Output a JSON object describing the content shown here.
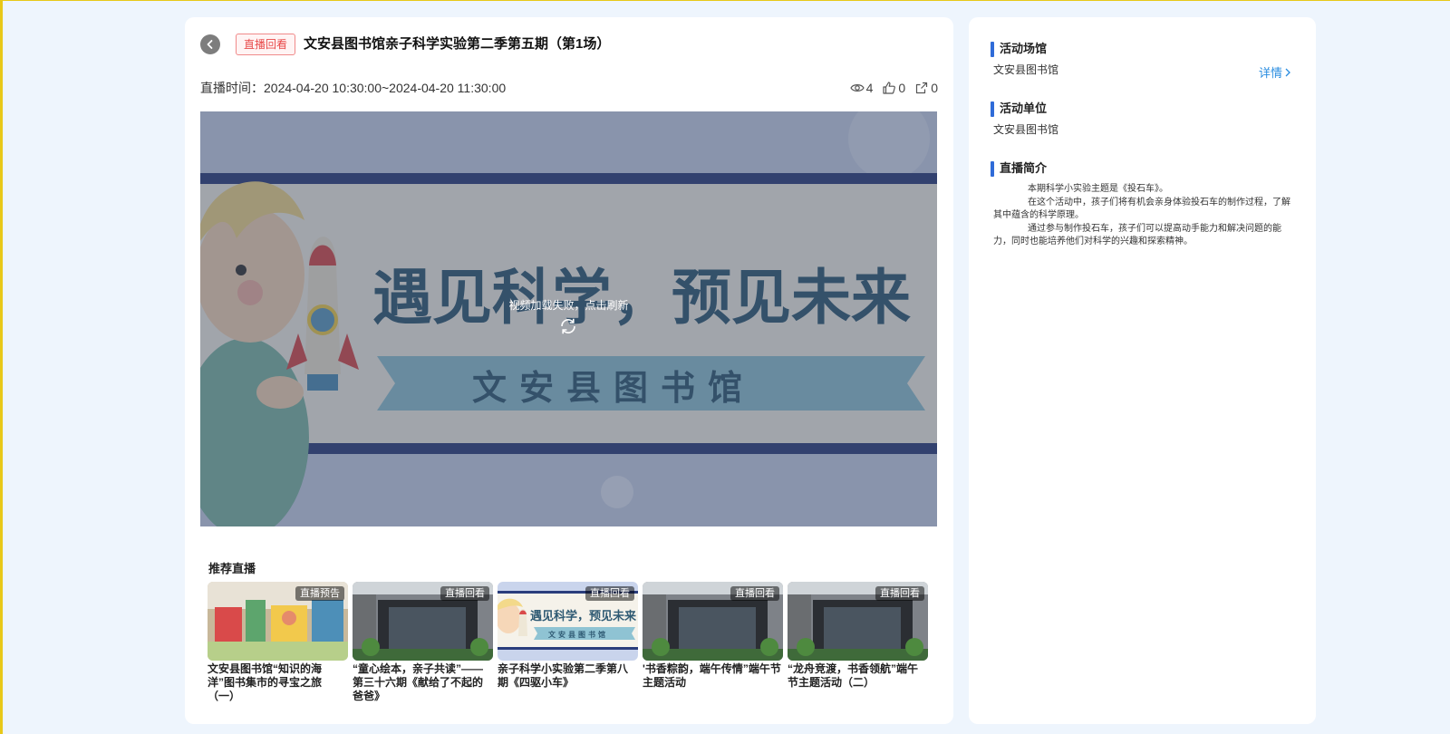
{
  "header": {
    "status_tag": "直播回看",
    "title": "文安县图书馆亲子科学实验第二季第五期（第1场）",
    "live_time_label": "直播时间：",
    "live_time_value": "2024-04-20 10:30:00~2024-04-20 11:30:00"
  },
  "stats": {
    "views": "4",
    "likes": "0",
    "shares": "0",
    "views_icon": "eye-icon",
    "likes_icon": "thumbs-up-icon",
    "shares_icon": "share-icon"
  },
  "video": {
    "poster_headline": "遇见科学，预见未来",
    "poster_subtitle": "文安县图书馆",
    "error_text": "视频加载失败，点击刷新"
  },
  "recommend": {
    "title": "推荐直播",
    "items": [
      {
        "badge": "直播预告",
        "title": "文安县图书馆“知识的海洋”图书集市的寻宝之旅（一）"
      },
      {
        "badge": "直播回看",
        "title": "“童心绘本，亲子共读”——第三十六期《献给了不起的爸爸》"
      },
      {
        "badge": "直播回看",
        "title": "亲子科学小实验第二季第八期《四驱小车》",
        "thumb_text": "遇见科学，预见未来",
        "thumb_sub": "文安县图书馆"
      },
      {
        "badge": "直播回看",
        "title": "'书香粽韵，端午传情”端午节主题活动"
      },
      {
        "badge": "直播回看",
        "title": "“龙舟竞渡，书香领航”端午节主题活动（二）"
      }
    ]
  },
  "sidebar": {
    "venue_title": "活动场馆",
    "venue_value": "文安县图书馆",
    "detail_link": "详情",
    "organizer_title": "活动单位",
    "organizer_value": "文安县图书馆",
    "intro_title": "直播简介",
    "intro_paragraphs": [
      "本期科学小实验主题是《投石车》。",
      "在这个活动中，孩子们将有机会亲身体验投石车的制作过程，了解其中蕴含的科学原理。",
      "通过参与制作投石车，孩子们可以提高动手能力和解决问题的能力，同时也能培养他们对科学的兴趣和探索精神。"
    ]
  },
  "colors": {
    "accent_blue": "#2f6bd8",
    "link_blue": "#2a8de0",
    "tag_red": "#e84a4a",
    "page_bg": "#eef5fd"
  }
}
